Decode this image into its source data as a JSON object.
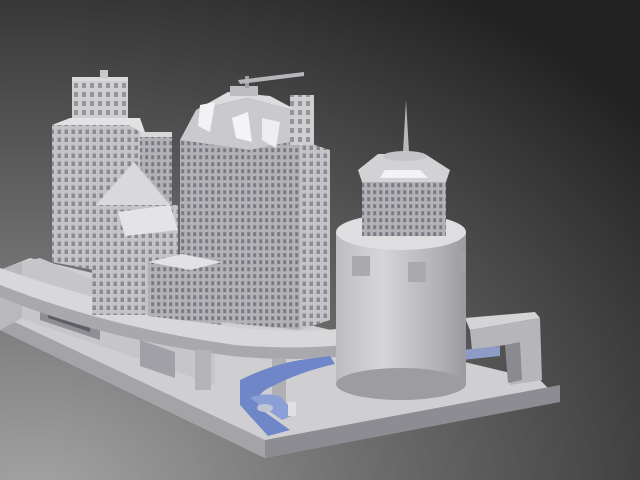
{
  "scene": {
    "colors": {
      "bg_light": "#9a9a9a",
      "bg_dark": "#242424",
      "model_light": "#d4d4d6",
      "model_mid": "#b4b4b8",
      "model_dark": "#8e8e94",
      "window": "#7c7c84",
      "water": "#6f86c8"
    }
  }
}
